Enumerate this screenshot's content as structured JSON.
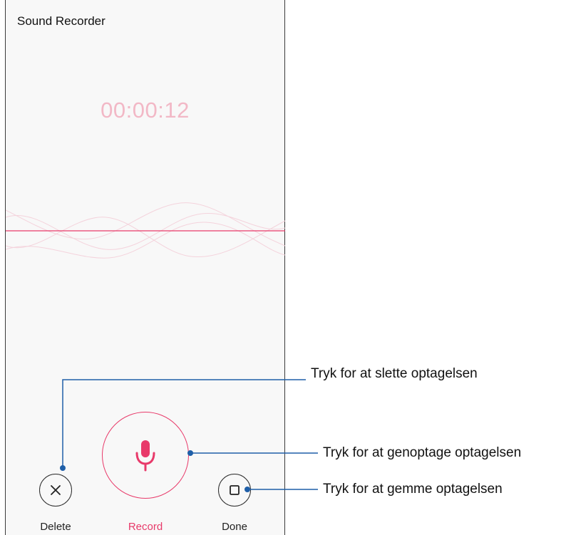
{
  "app": {
    "title": "Sound Recorder"
  },
  "recorder": {
    "elapsed_time": "00:00:12",
    "state": "paused"
  },
  "controls": {
    "delete_label": "Delete",
    "record_label": "Record",
    "done_label": "Done"
  },
  "icons": {
    "delete": "close-icon",
    "record": "microphone-icon",
    "done": "square-stop-icon"
  },
  "annotations": {
    "delete_callout": "Tryk for at slette optagelsen",
    "record_callout": "Tryk for at genoptage optagelsen",
    "done_callout": "Tryk for at gemme optagelsen"
  },
  "colors": {
    "accent": "#e83a6a",
    "timer": "#f2b8c6",
    "callout_line": "#1f5fa8",
    "background": "#f8f8f8"
  }
}
